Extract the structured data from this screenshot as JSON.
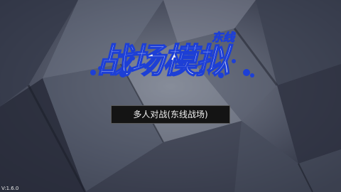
{
  "game": {
    "title": "战场模拟",
    "subtitle": "东线",
    "title_color": "#f4f4f4",
    "accent_color": "#1d3fd6"
  },
  "menu": {
    "items": [
      {
        "label": "多人对战(东线战场)"
      }
    ]
  },
  "footer": {
    "version": "V:1.6.0"
  }
}
